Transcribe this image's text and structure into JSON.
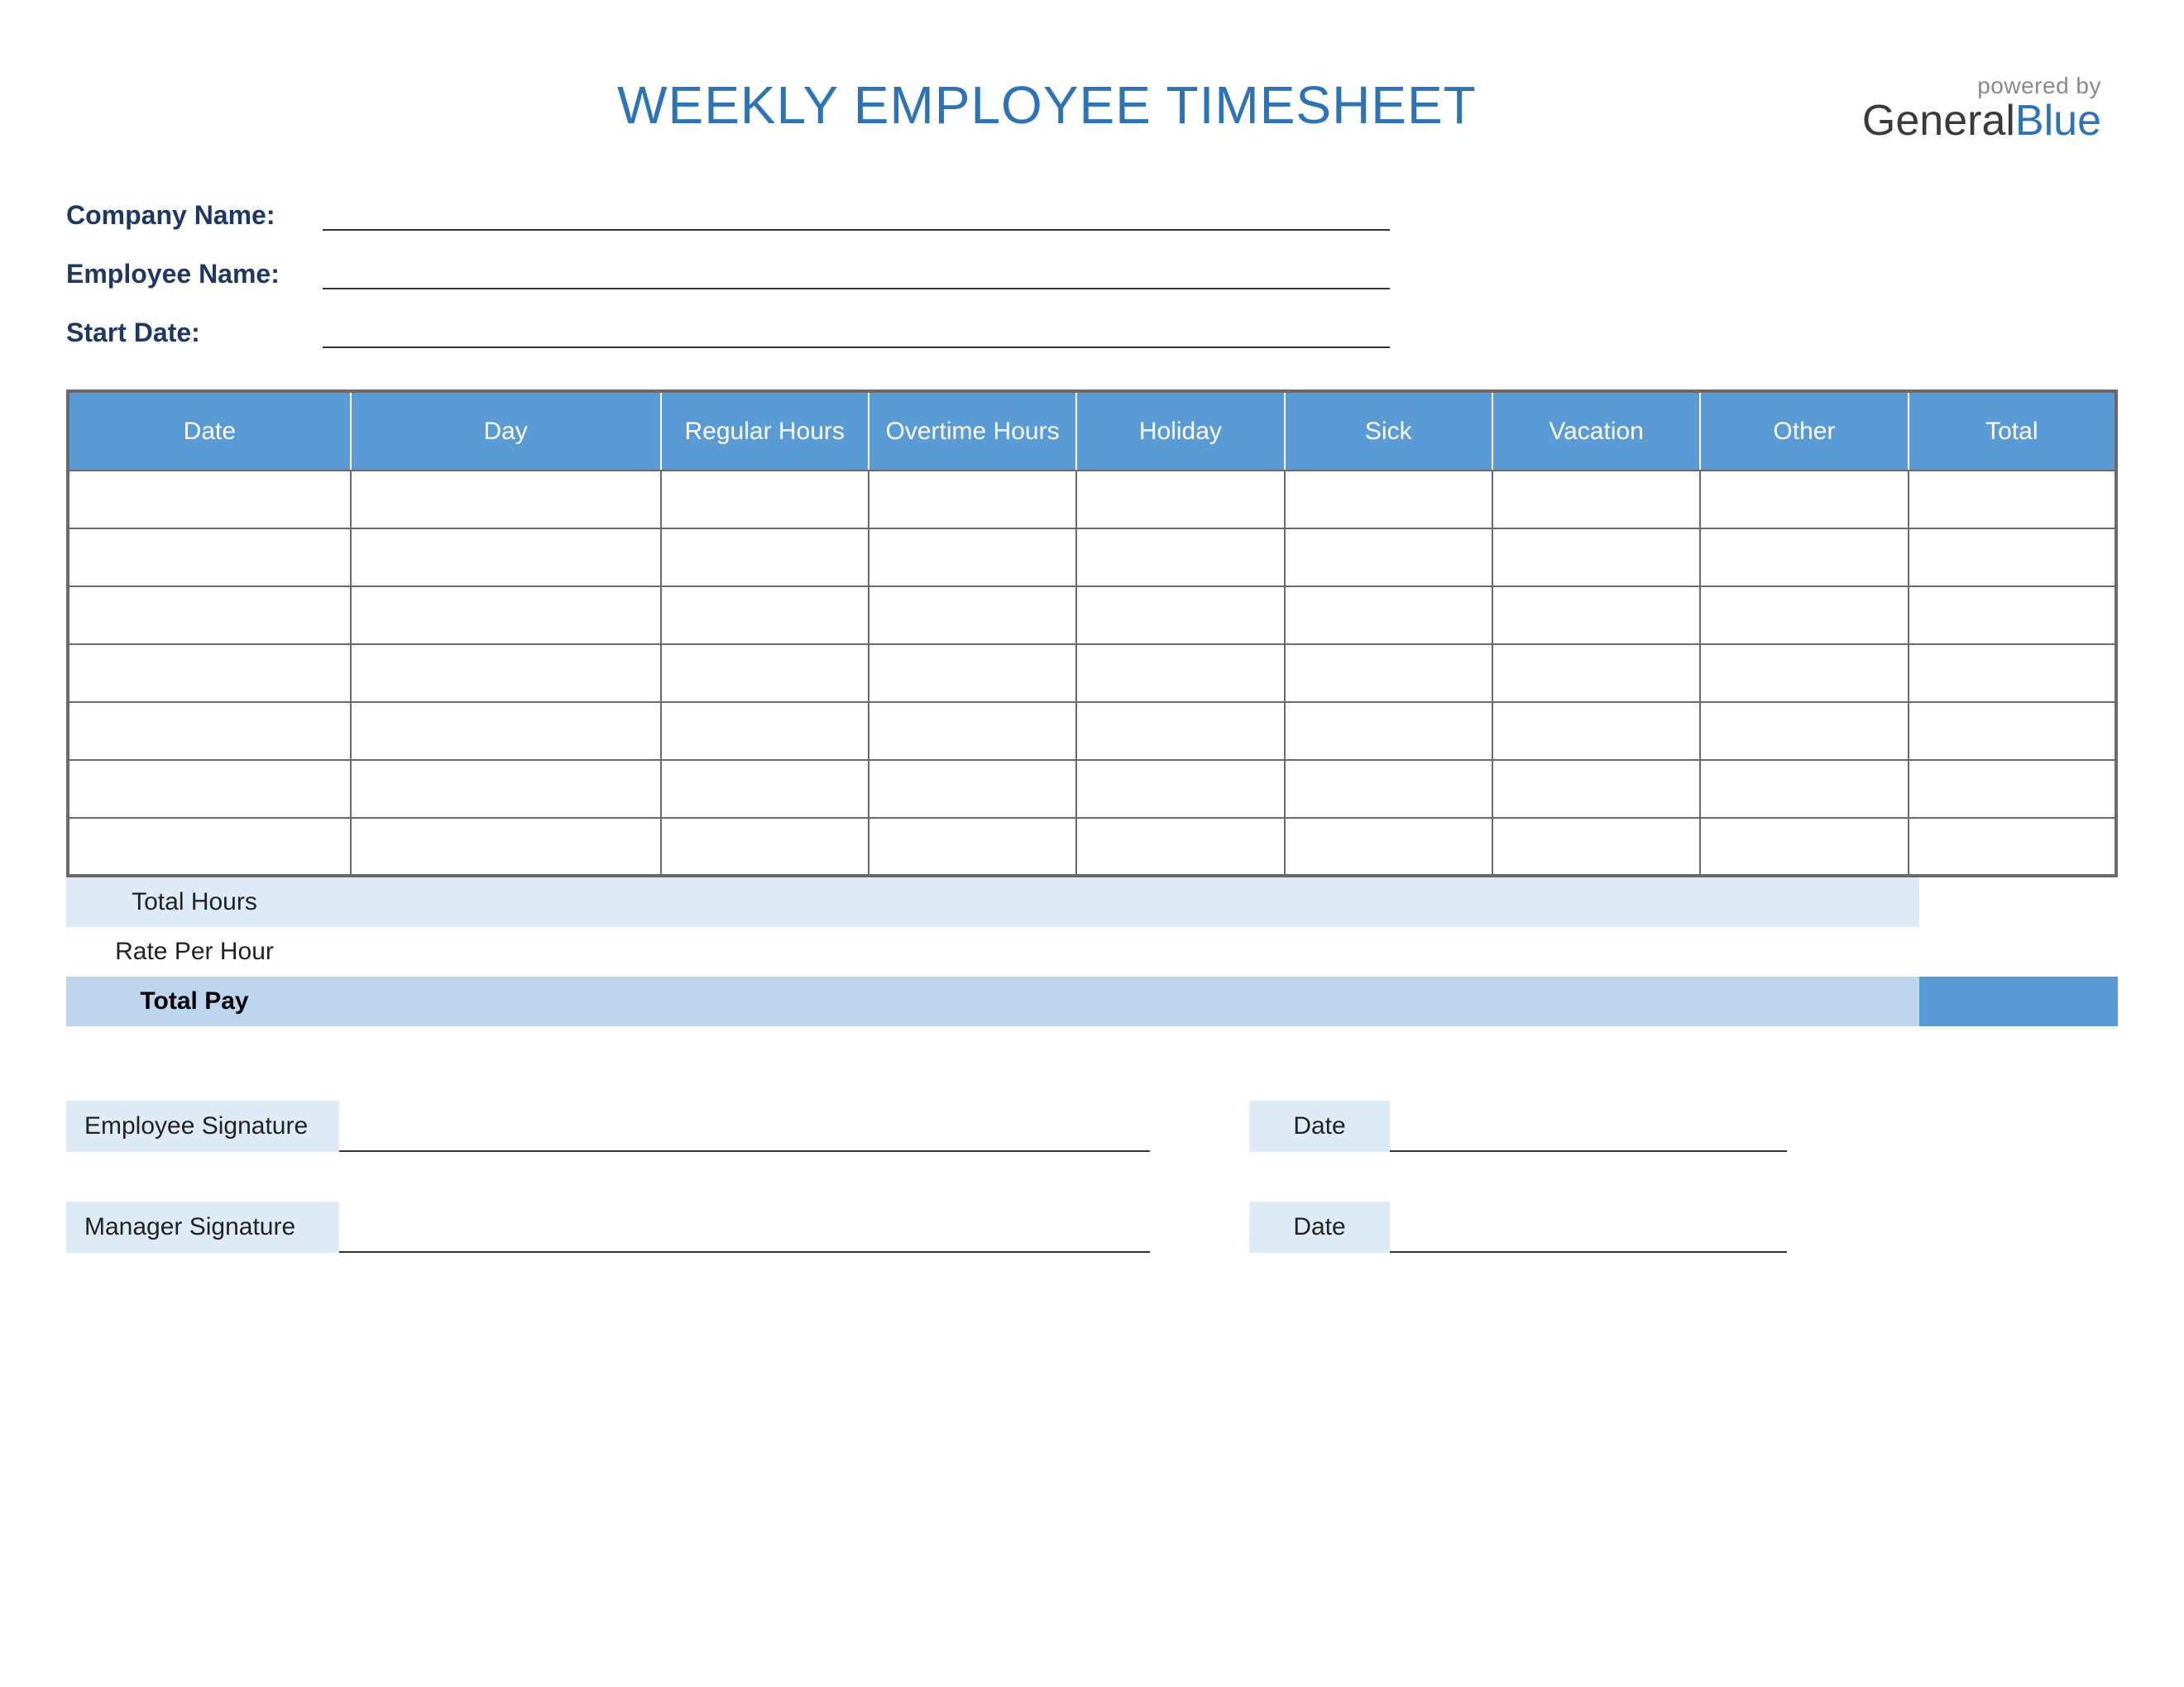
{
  "header": {
    "title": "WEEKLY EMPLOYEE TIMESHEET",
    "powered_by": "powered by",
    "logo_part1": "General",
    "logo_part2": "Blue"
  },
  "info": {
    "company_label": "Company Name:",
    "employee_label": "Employee Name:",
    "start_date_label": "Start Date:",
    "company_value": "",
    "employee_value": "",
    "start_date_value": ""
  },
  "table": {
    "columns": [
      "Date",
      "Day",
      "Regular Hours",
      "Overtime Hours",
      "Holiday",
      "Sick",
      "Vacation",
      "Other",
      "Total"
    ],
    "rows": [
      [
        "",
        "",
        "",
        "",
        "",
        "",
        "",
        "",
        ""
      ],
      [
        "",
        "",
        "",
        "",
        "",
        "",
        "",
        "",
        ""
      ],
      [
        "",
        "",
        "",
        "",
        "",
        "",
        "",
        "",
        ""
      ],
      [
        "",
        "",
        "",
        "",
        "",
        "",
        "",
        "",
        ""
      ],
      [
        "",
        "",
        "",
        "",
        "",
        "",
        "",
        "",
        ""
      ],
      [
        "",
        "",
        "",
        "",
        "",
        "",
        "",
        "",
        ""
      ],
      [
        "",
        "",
        "",
        "",
        "",
        "",
        "",
        "",
        ""
      ]
    ]
  },
  "summary": {
    "total_hours_label": "Total Hours",
    "rate_label": "Rate Per Hour",
    "total_pay_label": "Total Pay"
  },
  "signatures": {
    "employee_label": "Employee Signature",
    "manager_label": "Manager Signature",
    "date_label": "Date"
  }
}
